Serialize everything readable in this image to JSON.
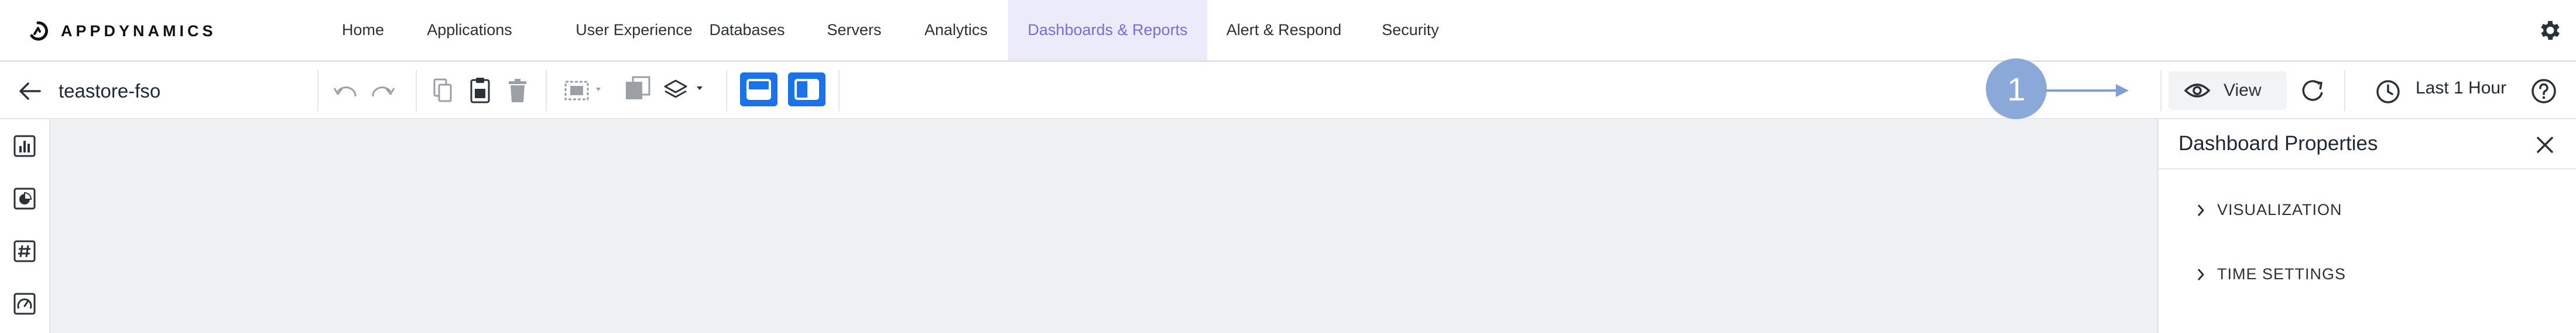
{
  "brand": {
    "name": "APPDYNAMICS"
  },
  "nav": {
    "items": [
      {
        "label": "Home"
      },
      {
        "label": "Applications"
      },
      {
        "label": "User Experience"
      },
      {
        "label": "Databases"
      },
      {
        "label": "Servers"
      },
      {
        "label": "Analytics"
      },
      {
        "label": "Dashboards & Reports",
        "active": true
      },
      {
        "label": "Alert & Respond"
      },
      {
        "label": "Security"
      }
    ]
  },
  "toolbar": {
    "dashboard_name": "teastore-fso",
    "view_label": "View",
    "time_range": "Last 1 Hour",
    "callout_number": "1"
  },
  "panel": {
    "title": "Dashboard Properties",
    "sections": [
      {
        "label": "VISUALIZATION"
      },
      {
        "label": "TIME SETTINGS"
      }
    ]
  },
  "icons": {
    "settings": "gear-icon",
    "back": "arrow-left-icon",
    "undo": "undo-icon",
    "redo": "redo-icon",
    "copy": "copy-icon",
    "paste": "clipboard-icon",
    "delete": "trash-icon",
    "view": "eye-icon",
    "refresh": "refresh-icon",
    "time": "clock-icon",
    "help": "help-icon"
  },
  "colors": {
    "accent": "#1a73e8",
    "active_nav_bg": "#ecebfb",
    "active_nav_text": "#7a6ad8",
    "callout": "#8aa8d8",
    "canvas": "#f0f1f3"
  }
}
